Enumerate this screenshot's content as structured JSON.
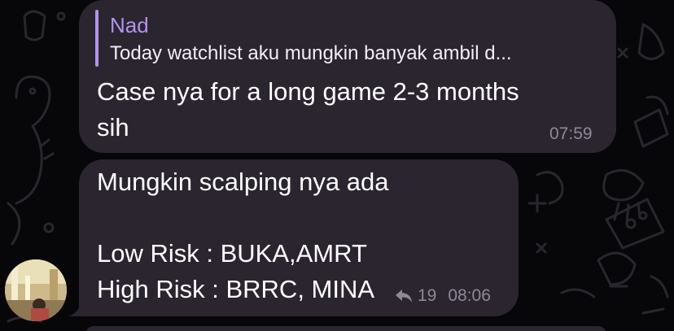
{
  "colors": {
    "background": "#070608",
    "bubble": "#2b2530",
    "reply_accent": "#b392f0",
    "meta_text": "#8f8896",
    "doodle_stroke": "#2a2630"
  },
  "messages": [
    {
      "reply_to": {
        "name": "Nad",
        "preview": "Today watchlist aku mungkin banyak ambil d..."
      },
      "lines": [
        "Case nya for a long game 2-3 months",
        "sih"
      ],
      "time": "07:59"
    },
    {
      "lines": [
        "Mungkin scalping nya ada",
        "",
        "Low Risk : BUKA,AMRT",
        "High Risk : BRRC, MINA"
      ],
      "reply_count": "19",
      "time": "08:06",
      "icons": [
        "reply-arrow-icon",
        "avatar"
      ]
    }
  ]
}
